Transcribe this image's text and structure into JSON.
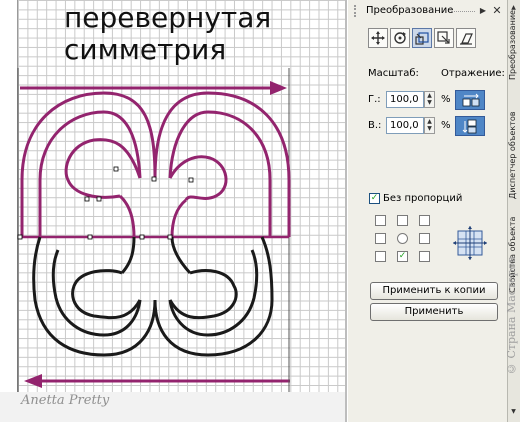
{
  "canvas": {
    "title_line1": "перевернутая",
    "title_line2": "симметрия",
    "watermark": "Anetta Pretty",
    "colors": {
      "purple": "#93246e",
      "black": "#1a1a1a",
      "grid": "#c9c9c9"
    }
  },
  "panel": {
    "title": "Преобразование",
    "header_icons": [
      "menu-arrow-icon",
      "close-icon"
    ],
    "tools": [
      {
        "name": "position-tool",
        "icon": "move-cross-icon"
      },
      {
        "name": "rotate-tool",
        "icon": "rotate-icon"
      },
      {
        "name": "scale-mirror-tool",
        "icon": "scale-mirror-icon",
        "active": true
      },
      {
        "name": "size-tool",
        "icon": "size-icon"
      },
      {
        "name": "skew-tool",
        "icon": "skew-icon"
      }
    ],
    "scale_label": "Масштаб:",
    "mirror_label": "Отражение:",
    "h_label": "Г.:",
    "h_value": "100,0",
    "v_label": "В.:",
    "v_value": "100,0",
    "percent": "%",
    "proportion_label": "Без пропорций",
    "proportion_checked": true,
    "anchor_selected": "bottom-center",
    "apply_copy_label": "Применить к копии",
    "apply_label": "Применить",
    "accent": "#4f86c6"
  },
  "side_tabs": [
    "Преобразование",
    "Диспетчер объектов",
    "Свойства объекта"
  ],
  "side_watermark": "© Страна Мастеров"
}
